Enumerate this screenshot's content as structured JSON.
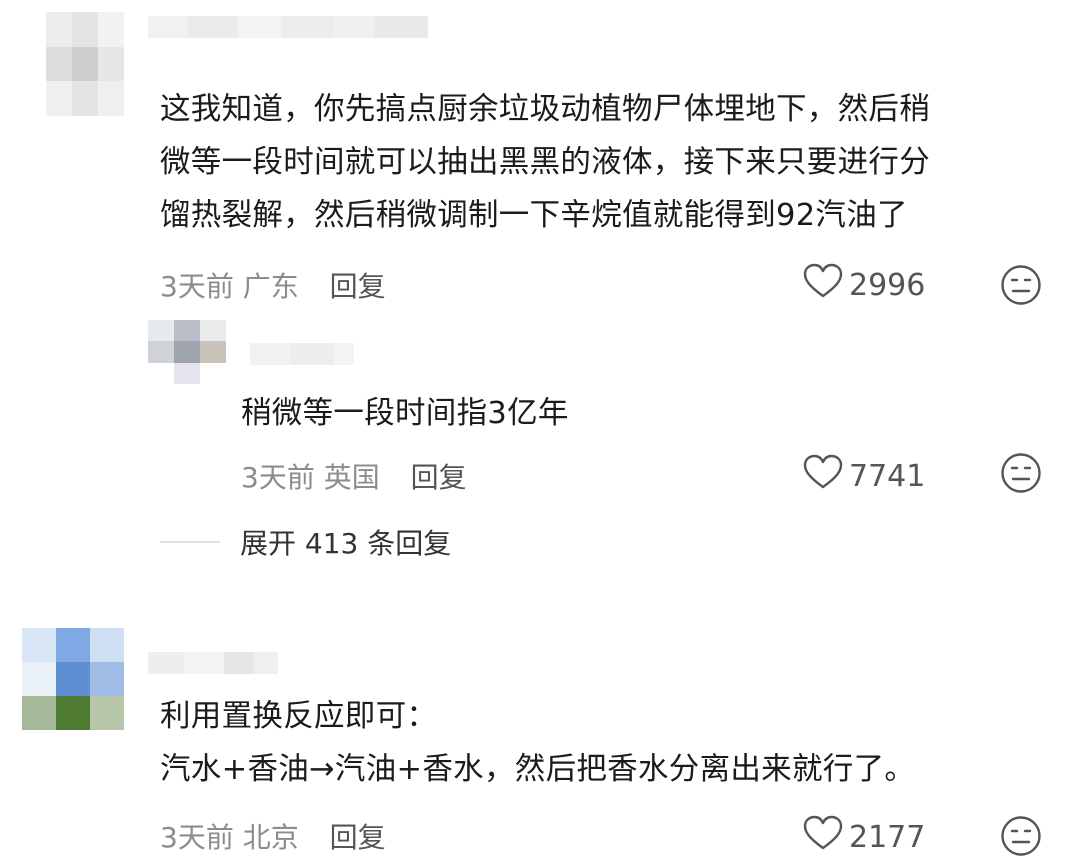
{
  "comments": [
    {
      "text_lines": [
        "这我知道，你先搞点厨余垃圾动植物尸体埋地下，然后稍",
        "微等一段时间就可以抽出黑黑的液体，接下来只要进行分",
        "馏热裂解，然后稍微调制一下辛烷值就能得到92汽油了"
      ],
      "time": "3天前",
      "location": "广东",
      "reply_label": "回复",
      "likes": "2996",
      "replies": [
        {
          "text": "稍微等一段时间指3亿年",
          "time": "3天前",
          "location": "英国",
          "reply_label": "回复",
          "likes": "7741"
        }
      ],
      "expand_label": "展开 413 条回复"
    },
    {
      "text_lines": [
        "利用置换反应即可：",
        "汽水+香油→汽油+香水，然后把香水分离出来就行了。"
      ],
      "time": "3天前",
      "location": "北京",
      "reply_label": "回复",
      "likes": "2177"
    }
  ],
  "icons": {
    "like": "heart-icon",
    "dislike": "meh-face-icon"
  },
  "colors": {
    "text": "#1b1b1b",
    "meta": "#8c8c8c",
    "icon": "#555555"
  }
}
